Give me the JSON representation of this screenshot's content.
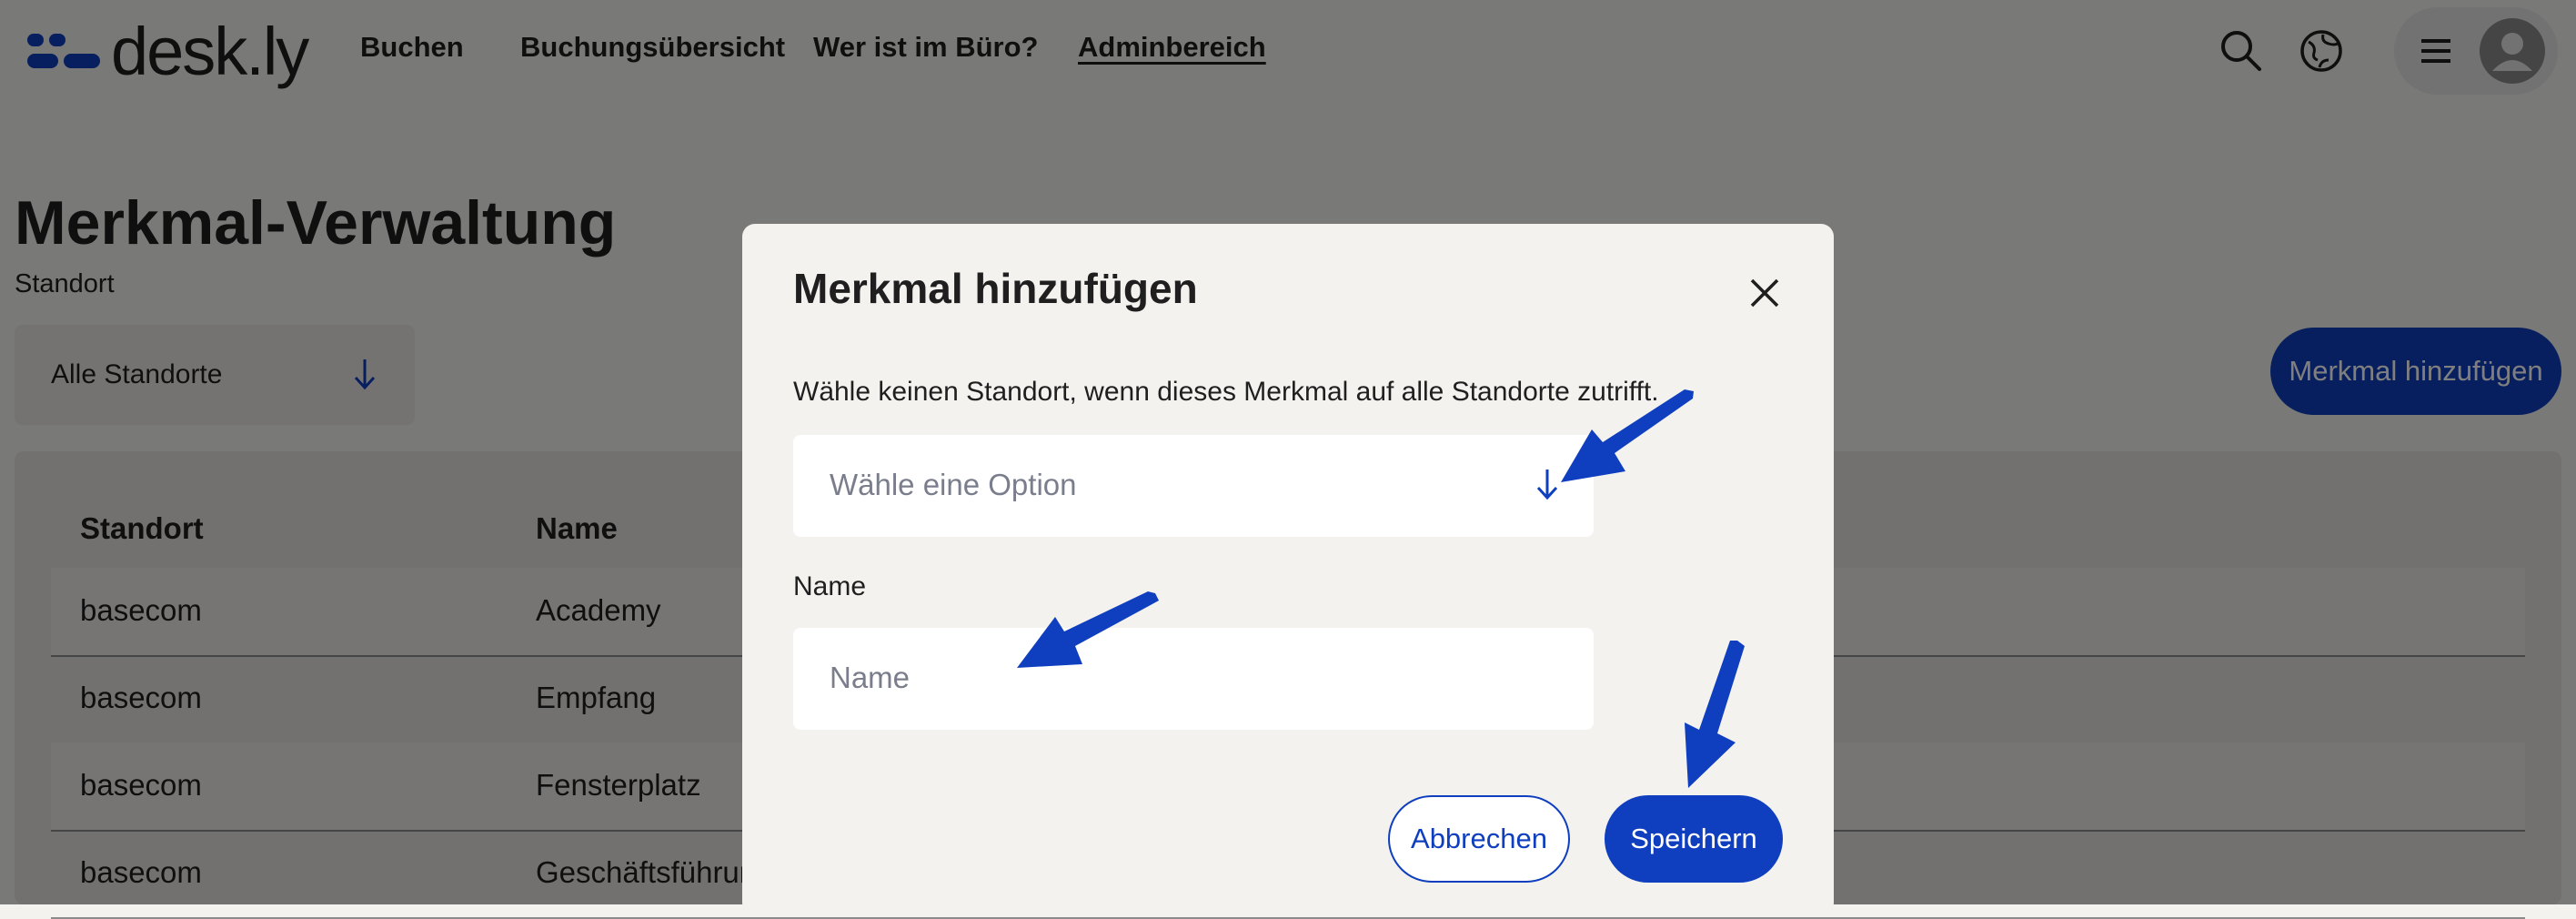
{
  "brand": {
    "name": "desk.ly",
    "color": "#0f3fbf"
  },
  "nav": {
    "items": [
      {
        "label": "Buchen"
      },
      {
        "label": "Buchungsübersicht"
      },
      {
        "label": "Wer ist im Büro?"
      },
      {
        "label": "Adminbereich",
        "active": true
      }
    ]
  },
  "header_icons": [
    "search-icon",
    "globe-icon",
    "menu-icon",
    "avatar"
  ],
  "page": {
    "title": "Merkmal-Verwaltung",
    "location_label": "Standort",
    "location_select_value": "Alle Standorte",
    "add_button": "Merkmal hinzufügen"
  },
  "table": {
    "headers": [
      "Standort",
      "Name"
    ],
    "rows": [
      {
        "standort": "basecom",
        "name": "Academy"
      },
      {
        "standort": "basecom",
        "name": "Empfang"
      },
      {
        "standort": "basecom",
        "name": "Fensterplatz"
      },
      {
        "standort": "basecom",
        "name": "Geschäftsführun"
      }
    ]
  },
  "modal": {
    "title": "Merkmal hinzufügen",
    "hint": "Wähle keinen Standort, wenn dieses Merkmal auf alle Standorte zutrifft.",
    "location_placeholder": "Wähle eine Option",
    "name_label": "Name",
    "name_placeholder": "Name",
    "cancel": "Abbrechen",
    "save": "Speichern"
  },
  "colors": {
    "accent": "#0f3fbf",
    "background": "#f3f2ef",
    "overlay": "rgba(0,0,0,0.5)"
  }
}
